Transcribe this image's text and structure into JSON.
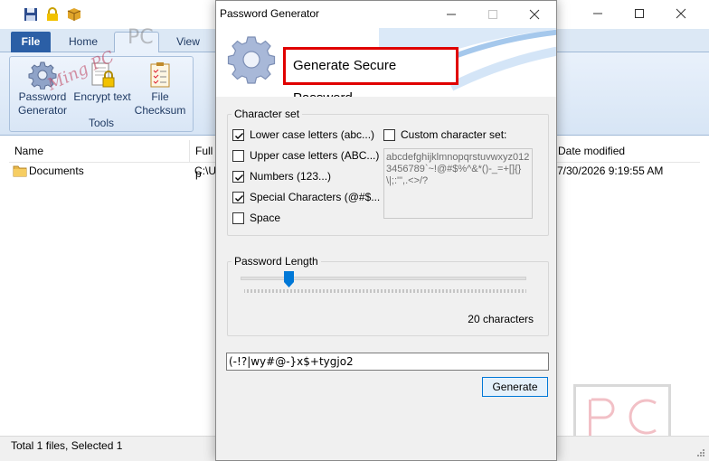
{
  "app": {
    "tabs": {
      "file": "File",
      "home": "Home",
      "tools": "PC",
      "view": "View"
    },
    "ribbon": {
      "buttons": [
        {
          "label": "Password Generator"
        },
        {
          "label": "Encrypt text"
        },
        {
          "label": "File Checksum"
        }
      ],
      "group_label": "Tools"
    },
    "watermark": "Ming PC",
    "list": {
      "columns": [
        "Name",
        "Full p",
        "Date modified"
      ],
      "rows": [
        {
          "name": "Documents",
          "path": "C:\\U",
          "modified": "7/30/2026 9:19:55 AM"
        }
      ]
    },
    "status": "Total 1 files, Selected 1"
  },
  "dialog": {
    "title": "Password Generator",
    "header_title": "Generate Secure Password",
    "charset": {
      "legend": "Character set",
      "options": [
        {
          "label": "Lower case letters (abc...)",
          "checked": true
        },
        {
          "label": "Upper case letters (ABC...)",
          "checked": false
        },
        {
          "label": "Numbers (123...)",
          "checked": true
        },
        {
          "label": "Special Characters (@#$...",
          "checked": true
        },
        {
          "label": "Space",
          "checked": false
        }
      ],
      "custom_label": "Custom character set:",
      "custom_checked": false,
      "custom_value": "abcdefghijklmnopqrstuvwxyz0123456789`~!@#$%^&*()-_=+[]{}\\|;:'\",.<>/?"
    },
    "length": {
      "legend": "Password Length",
      "value_label": "20 characters",
      "slider_fraction": 0.17
    },
    "password": "(-!?|wy#@-}x$+tygjo2",
    "generate_label": "Generate"
  },
  "colors": {
    "accent": "#0078d7",
    "highlight_border": "#e00000",
    "ribbon_file_tab": "#2b5fa6"
  }
}
